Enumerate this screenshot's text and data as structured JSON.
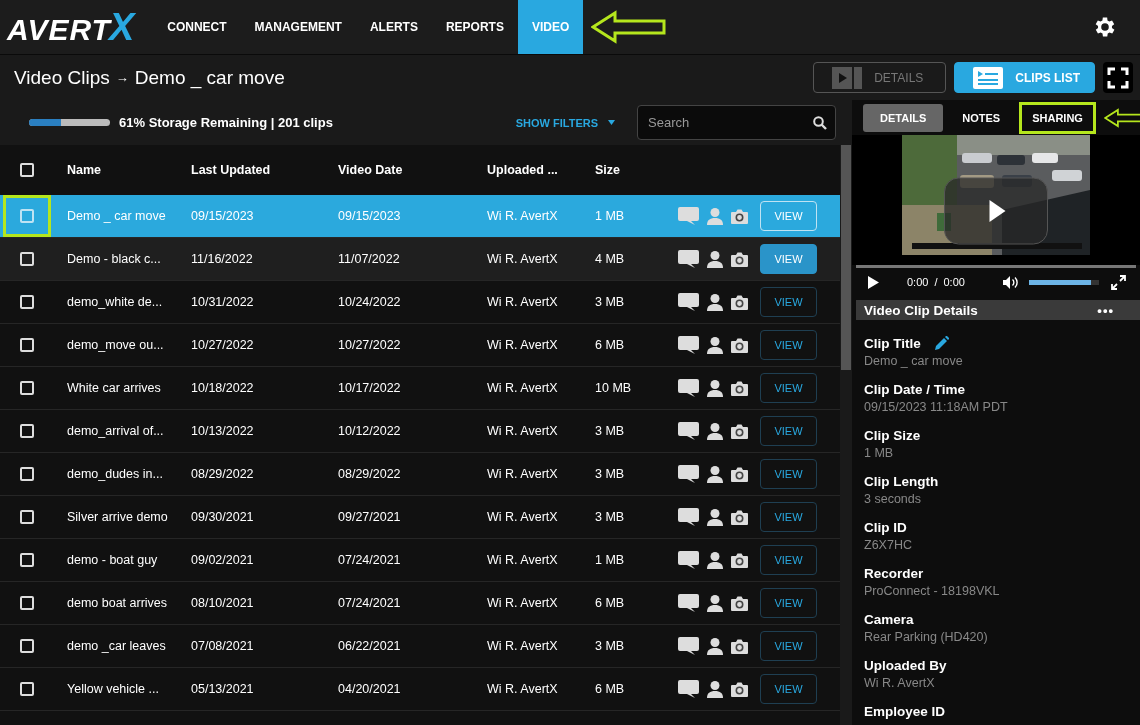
{
  "logo": {
    "text": "AVERT",
    "mark": "X"
  },
  "nav": [
    {
      "label": "CONNECT",
      "selected": false,
      "arrow": false
    },
    {
      "label": "MANAGEMENT",
      "selected": false,
      "arrow": false
    },
    {
      "label": "ALERTS",
      "selected": false,
      "arrow": false
    },
    {
      "label": "REPORTS",
      "selected": false,
      "arrow": false
    },
    {
      "label": "VIDEO",
      "selected": true,
      "arrow": true
    }
  ],
  "breadcrumb": {
    "parent": "Video Clips",
    "separator": "→",
    "current": "Demo _ car move"
  },
  "header_buttons": [
    {
      "kind": "details",
      "label": "DETAILS",
      "disabled": true
    },
    {
      "kind": "list",
      "label": "CLIPS LIST",
      "disabled": false
    },
    {
      "kind": "fullscreen",
      "disabled": false
    }
  ],
  "storage": {
    "level": 0.39,
    "text": "61% Storage Remaining | 201 clips"
  },
  "filters": {
    "label": "SHOW FILTERS"
  },
  "search": {
    "placeholder": "Search"
  },
  "table": {
    "columns": [
      "Name",
      "Last Updated",
      "Video Date",
      "Uploaded ...",
      "Size"
    ],
    "select_all_checked": false,
    "rows": [
      {
        "name": "Demo _ car move",
        "updated": "09/15/2023",
        "video_date": "09/15/2023",
        "uploader": "Wi R. AvertX",
        "size": "1 MB",
        "view": "VIEW",
        "selected": true,
        "checked": false,
        "hovered": false,
        "highlighted": true
      },
      {
        "name": "Demo - black c...",
        "updated": "11/16/2022",
        "video_date": "11/07/2022",
        "uploader": "Wi R. AvertX",
        "size": "4 MB",
        "view": "VIEW",
        "selected": false,
        "checked": false,
        "hovered": true,
        "highlighted": false
      },
      {
        "name": "demo_white de...",
        "updated": "10/31/2022",
        "video_date": "10/24/2022",
        "uploader": "Wi R. AvertX",
        "size": "3 MB",
        "view": "VIEW",
        "selected": false,
        "checked": false,
        "hovered": false,
        "highlighted": false
      },
      {
        "name": "demo_move ou...",
        "updated": "10/27/2022",
        "video_date": "10/27/2022",
        "uploader": "Wi R. AvertX",
        "size": "6 MB",
        "view": "VIEW",
        "selected": false,
        "checked": false,
        "hovered": false,
        "highlighted": false
      },
      {
        "name": "White car arrives",
        "updated": "10/18/2022",
        "video_date": "10/17/2022",
        "uploader": "Wi R. AvertX",
        "size": "10 MB",
        "view": "VIEW",
        "selected": false,
        "checked": false,
        "hovered": false,
        "highlighted": false
      },
      {
        "name": "demo_arrival of...",
        "updated": "10/13/2022",
        "video_date": "10/12/2022",
        "uploader": "Wi R. AvertX",
        "size": "3 MB",
        "view": "VIEW",
        "selected": false,
        "checked": false,
        "hovered": false,
        "highlighted": false
      },
      {
        "name": "demo_dudes in...",
        "updated": "08/29/2022",
        "video_date": "08/29/2022",
        "uploader": "Wi R. AvertX",
        "size": "3 MB",
        "view": "VIEW",
        "selected": false,
        "checked": false,
        "hovered": false,
        "highlighted": false
      },
      {
        "name": "Silver arrive demo",
        "updated": "09/30/2021",
        "video_date": "09/27/2021",
        "uploader": "Wi R. AvertX",
        "size": "3 MB",
        "view": "VIEW",
        "selected": false,
        "checked": false,
        "hovered": false,
        "highlighted": false
      },
      {
        "name": "demo - boat guy",
        "updated": "09/02/2021",
        "video_date": "07/24/2021",
        "uploader": "Wi R. AvertX",
        "size": "1 MB",
        "view": "VIEW",
        "selected": false,
        "checked": false,
        "hovered": false,
        "highlighted": false
      },
      {
        "name": "demo boat arrives",
        "updated": "08/10/2021",
        "video_date": "07/24/2021",
        "uploader": "Wi R. AvertX",
        "size": "6 MB",
        "view": "VIEW",
        "selected": false,
        "checked": false,
        "hovered": false,
        "highlighted": false
      },
      {
        "name": "demo _car leaves",
        "updated": "07/08/2021",
        "video_date": "06/22/2021",
        "uploader": "Wi R. AvertX",
        "size": "3 MB",
        "view": "VIEW",
        "selected": false,
        "checked": false,
        "hovered": false,
        "highlighted": false
      },
      {
        "name": "Yellow vehicle ...",
        "updated": "05/13/2021",
        "video_date": "04/20/2021",
        "uploader": "Wi R. AvertX",
        "size": "6 MB",
        "view": "VIEW",
        "selected": false,
        "checked": false,
        "hovered": false,
        "highlighted": false
      }
    ]
  },
  "side_tabs": [
    {
      "label": "DETAILS",
      "selected": true,
      "highlighted": false
    },
    {
      "label": "NOTES",
      "selected": false,
      "highlighted": false
    },
    {
      "label": "SHARING",
      "selected": false,
      "highlighted": true
    }
  ],
  "player": {
    "current": "0:00",
    "separator": "/",
    "duration": "0:00",
    "volume": {
      "level": 0.88
    }
  },
  "details": {
    "title": "Video Clip Details",
    "menu": "•••",
    "fields": [
      {
        "label": "Clip Title",
        "value": "Demo _ car move",
        "editable": true
      },
      {
        "label": "Clip Date / Time",
        "value": "09/15/2023 11:18AM PDT",
        "editable": false
      },
      {
        "label": "Clip Size",
        "value": "1 MB",
        "editable": false
      },
      {
        "label": "Clip Length",
        "value": "3 seconds",
        "editable": false
      },
      {
        "label": "Clip ID",
        "value": "Z6X7HC",
        "editable": false
      },
      {
        "label": "Recorder",
        "value": "ProConnect - 18198VKL",
        "editable": false
      },
      {
        "label": "Camera",
        "value": "Rear Parking (HD420)",
        "editable": false
      },
      {
        "label": "Uploaded By",
        "value": "Wi R. AvertX",
        "editable": false
      },
      {
        "label": "Employee ID",
        "editable": false
      }
    ]
  }
}
